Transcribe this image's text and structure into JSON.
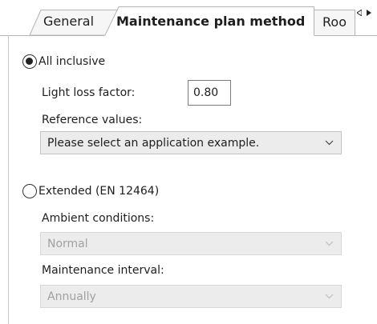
{
  "tabs": {
    "general": "General",
    "active": "Maintenance plan method",
    "room": "Roo",
    "scroll_left_icon": "triangle-left-icon",
    "scroll_right_icon": "triangle-right-icon"
  },
  "all_inclusive": {
    "radio_label": "All inclusive",
    "checked": true,
    "light_loss_label": "Light loss factor:",
    "light_loss_value": "0.80",
    "reference_label": "Reference values:",
    "reference_selected": "Please select an application example."
  },
  "extended": {
    "radio_label": "Extended (EN 12464)",
    "checked": false,
    "ambient_label": "Ambient conditions:",
    "ambient_selected": "Normal",
    "interval_label": "Maintenance interval:",
    "interval_selected": "Annually"
  },
  "colors": {
    "combo_bg": "#ececec",
    "disabled_text": "#a0a0a0",
    "tab_border": "#b4b4b4"
  }
}
